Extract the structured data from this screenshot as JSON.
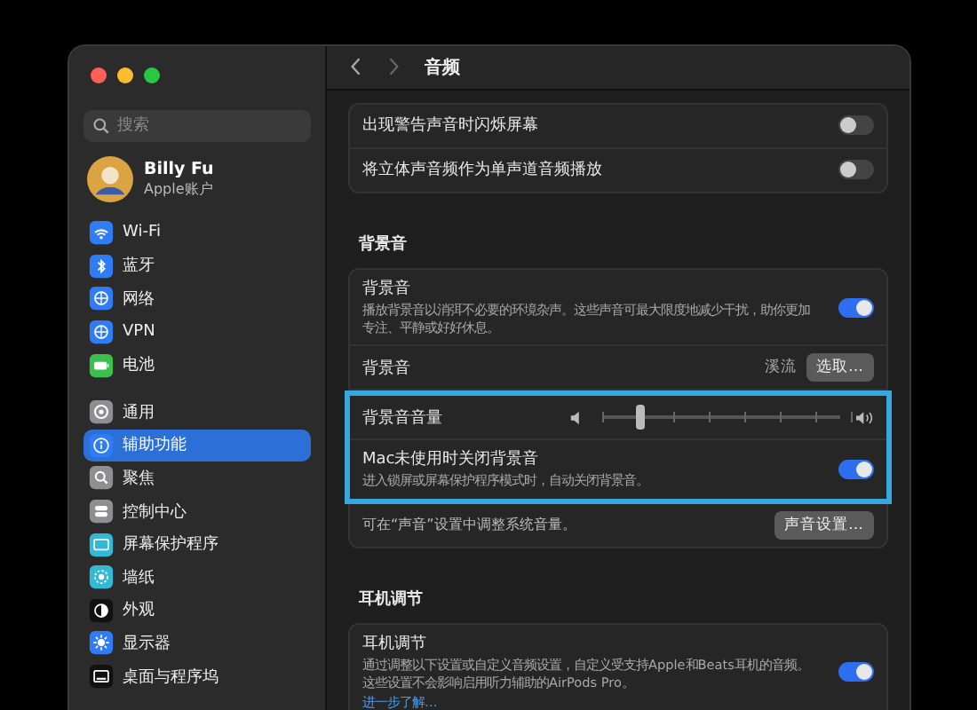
{
  "window": {
    "title": "音频"
  },
  "sidebar": {
    "search": {
      "placeholder": "搜索"
    },
    "profile": {
      "name": "Billy Fu",
      "subtitle": "Apple账户"
    },
    "groups": [
      [
        {
          "label": "Wi-Fi",
          "selected": false
        },
        {
          "label": "蓝牙",
          "selected": false
        },
        {
          "label": "网络",
          "selected": false
        },
        {
          "label": "VPN",
          "selected": false
        },
        {
          "label": "电池",
          "selected": false
        }
      ],
      [
        {
          "label": "通用",
          "selected": false
        },
        {
          "label": "辅助功能",
          "selected": true
        },
        {
          "label": "聚焦",
          "selected": false
        },
        {
          "label": "控制中心",
          "selected": false
        },
        {
          "label": "屏幕保护程序",
          "selected": false
        },
        {
          "label": "墙纸",
          "selected": false
        },
        {
          "label": "外观",
          "selected": false
        },
        {
          "label": "显示器",
          "selected": false
        },
        {
          "label": "桌面与程序坞",
          "selected": false
        }
      ]
    ]
  },
  "sections": [
    {
      "rows": [
        {
          "kind": "toggle",
          "label": "出现警告声音时闪烁屏幕",
          "on": false,
          "highlighted": false
        },
        {
          "kind": "toggle",
          "label": "将立体声音频作为单声道音频播放",
          "on": false,
          "highlighted": false
        }
      ]
    },
    {
      "heading": "背景音",
      "rows": [
        {
          "kind": "toggle",
          "label": "背景音",
          "description": "播放背景音以消弭不必要的环境杂声。这些声音可最大限度地减少干扰，助你更加专注、平静或好好休息。",
          "on": true,
          "highlighted": false
        },
        {
          "kind": "choice",
          "label": "背景音",
          "value": "溪流",
          "button": "选取…",
          "highlighted": false
        },
        {
          "kind": "slider",
          "label": "背景音音量",
          "level": 0.15,
          "highlighted": true
        },
        {
          "kind": "toggle",
          "label": "Mac未使用时关闭背景音",
          "description": "进入锁屏或屏幕保护程序模式时，自动关闭背景音。",
          "on": true,
          "highlighted": true
        },
        {
          "kind": "note",
          "label": "可在“声音”设置中调整系统音量。",
          "button": "声音设置…",
          "highlighted": false
        }
      ]
    },
    {
      "heading": "耳机调节",
      "rows": [
        {
          "kind": "toggle",
          "label": "耳机调节",
          "description": "通过调整以下设置或自定义音频设置，自定义受支持Apple和Beats耳机的音频。这些设置不会影响启用听力辅助的AirPods Pro。",
          "link": "进一步了解…",
          "on": true,
          "highlighted": false
        }
      ]
    }
  ]
}
